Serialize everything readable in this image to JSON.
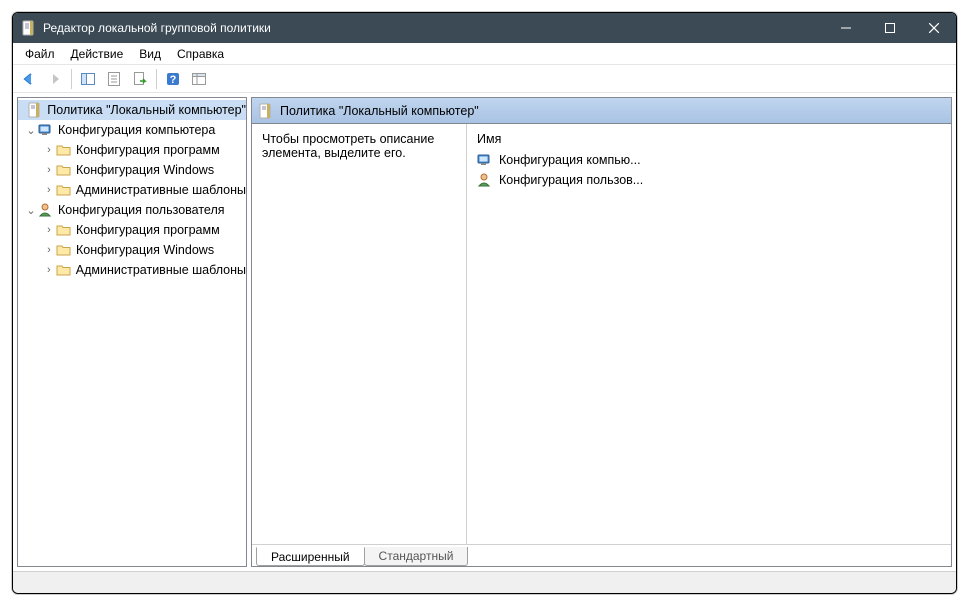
{
  "title": "Редактор локальной групповой политики",
  "menu": {
    "file": "Файл",
    "action": "Действие",
    "view": "Вид",
    "help": "Справка"
  },
  "tree": {
    "root": "Политика \"Локальный компьютер\"",
    "computer": "Конфигурация компьютера",
    "user": "Конфигурация пользователя",
    "soft": "Конфигурация программ",
    "win": "Конфигурация Windows",
    "admin": "Административные шаблоны"
  },
  "right": {
    "header": "Политика \"Локальный компьютер\"",
    "desc": "Чтобы просмотреть описание элемента, выделите его.",
    "col": "Имя",
    "item1": "Конфигурация компью...",
    "item2": "Конфигурация пользов..."
  },
  "tabs": {
    "ext": "Расширенный",
    "std": "Стандартный"
  }
}
